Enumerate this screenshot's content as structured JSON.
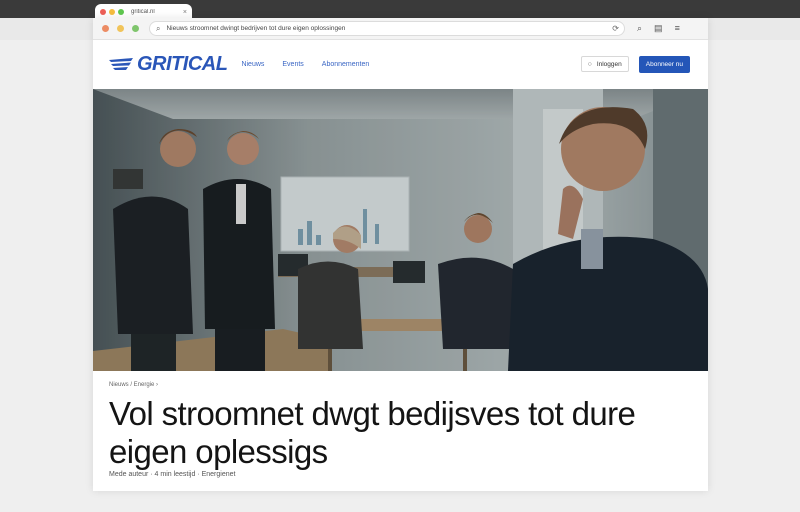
{
  "browser": {
    "tab_title": "gritical.nl",
    "url": "Nieuws stroomnet dwingt bedrijven tot dure eigen oplossingen",
    "colors": {
      "close": "#ed5f57",
      "minimize": "#f5bd3f",
      "maximize": "#5fc74f"
    }
  },
  "site": {
    "logo_text": "GRITICAL",
    "brand_color": "#2a56b8",
    "nav": [
      "Nieuws",
      "Events",
      "Abonnementen"
    ],
    "login_label": "Inloggen",
    "subscribe_label": "Abonneer nu"
  },
  "article": {
    "breadcrumb": "Nieuws / Energie ›",
    "headline": "Vol stroomnet dwgt bedijsves tot dure eigen oplessigs",
    "meta": "Mede auteur · 4 min leestijd · Energienet"
  }
}
